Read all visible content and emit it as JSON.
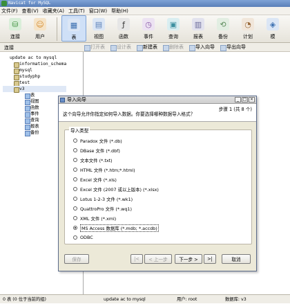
{
  "window": {
    "title": "Navicat for MySQL"
  },
  "menu": [
    "文件(F)",
    "查看(V)",
    "收藏夹(A)",
    "工具(T)",
    "窗口(W)",
    "帮助(H)"
  ],
  "toolbar": [
    {
      "label": "连接",
      "icon": "connect-icon",
      "color": "#3b8f3b"
    },
    {
      "label": "用户",
      "icon": "user-icon",
      "color": "#d48a2a"
    },
    {
      "label": "表",
      "icon": "table-icon",
      "color": "#3b6fb0",
      "active": true
    },
    {
      "label": "视图",
      "icon": "view-icon",
      "color": "#5a7fb8"
    },
    {
      "label": "函数",
      "icon": "function-icon",
      "color": "#5a7fb8"
    },
    {
      "label": "事件",
      "icon": "event-icon",
      "color": "#8a5aa8"
    },
    {
      "label": "查询",
      "icon": "query-icon",
      "color": "#3b8f9f"
    },
    {
      "label": "报表",
      "icon": "report-icon",
      "color": "#6a6a9a"
    },
    {
      "label": "备份",
      "icon": "backup-icon",
      "color": "#5a8a5a"
    },
    {
      "label": "计划",
      "icon": "schedule-icon",
      "color": "#9a6a3a"
    },
    {
      "label": "模",
      "icon": "model-icon",
      "color": "#3b6fb0"
    }
  ],
  "subbar": {
    "connection_label": "连接",
    "buttons": [
      {
        "label": "打开表",
        "disabled": true
      },
      {
        "label": "设计表",
        "disabled": true
      },
      {
        "label": "新建表",
        "disabled": false
      },
      {
        "label": "删除表",
        "disabled": true
      },
      {
        "label": "导入向导",
        "disabled": false
      },
      {
        "label": "导出向导",
        "disabled": false
      }
    ]
  },
  "tree": {
    "root": "update ac to mysql",
    "databases": [
      "information_schema",
      "mysql",
      "studyphp",
      "test",
      "v3"
    ],
    "children": [
      "表",
      "视图",
      "函数",
      "事件",
      "查询",
      "报表",
      "备份"
    ]
  },
  "dialog": {
    "title": "导入向导",
    "description": "这个向导允许你指定如何导入数据。你要选择哪种数据导入格式？",
    "step": "步骤 1 (共 8 个)",
    "group_title": "导入类型",
    "options": [
      "Paradox 文件 (*.db)",
      "DBase 文件 (*.dbf)",
      "文本文件 (*.txt)",
      "HTML 文件 (*.htm;*.html)",
      "Excel 文件 (*.xls)",
      "Excel 文件 (2007 或以上版本) (*.xlsx)",
      "Lotus 1-2-3 文件 (*.wk1)",
      "QuattroPro 文件 (*.wq1)",
      "XML 文件 (*.xml)",
      "MS Access 数据库 (*.mdb; *.accdb)",
      "ODBC"
    ],
    "selected_index": 9,
    "buttons": {
      "save": "保存",
      "first": "|<",
      "back": "< 上一步",
      "next": "下一步 >",
      "last": ">|",
      "cancel": "取消"
    }
  },
  "status": {
    "count": "0 表 (0 位于当前的组)",
    "connection": "update ac to mysql",
    "user": "用户: root",
    "database": "数据库: v3"
  }
}
